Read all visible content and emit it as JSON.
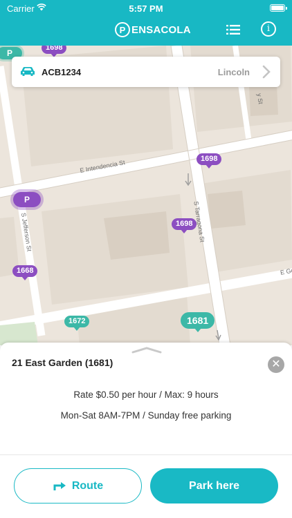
{
  "status_bar": {
    "carrier": "Carrier",
    "time": "5:57 PM"
  },
  "header": {
    "logo_letter": "P",
    "logo_text": "ENSACOLA",
    "list_icon": "list-icon",
    "info_icon": "info-icon",
    "color": "#18b8c4"
  },
  "vehicle": {
    "plate": "ACB1234",
    "city": "Lincoln",
    "icon": "car-icon"
  },
  "map": {
    "streets": [
      "E Intendencia St",
      "S Jefferson St",
      "S Tarragona St",
      "E Go",
      "y St"
    ],
    "markers": [
      {
        "label": "1698",
        "kind": "purple"
      },
      {
        "label": "1698",
        "kind": "purple"
      },
      {
        "label": "1698",
        "kind": "purple"
      },
      {
        "label": "1668",
        "kind": "purple"
      },
      {
        "label": "1672",
        "kind": "teal"
      },
      {
        "label": "1681",
        "kind": "teal"
      }
    ],
    "p_bubble": "P",
    "p_marker": "P"
  },
  "sheet": {
    "title": "21 East Garden (1681)",
    "rate": "Rate $0.50 per hour / Max: 9 hours",
    "hours": "Mon-Sat 8AM-7PM / Sunday free parking",
    "close_icon": "close-icon",
    "route_label": "Route",
    "park_label": "Park here"
  },
  "colors": {
    "accent": "#18b8c4",
    "purple": "#8c4ec1",
    "teal": "#3cb8a7"
  }
}
